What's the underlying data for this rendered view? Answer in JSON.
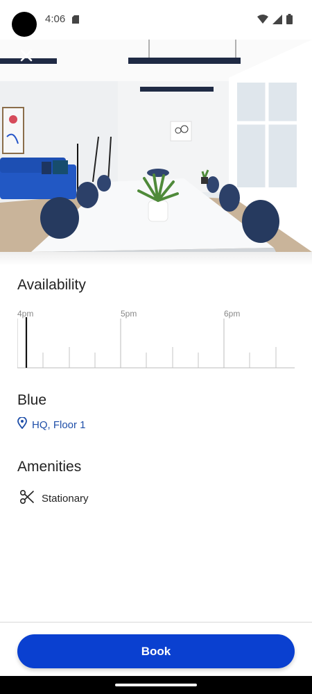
{
  "status_bar": {
    "time": "4:06",
    "icons": [
      "sd-card-icon",
      "wifi-icon",
      "signal-icon",
      "battery-icon"
    ]
  },
  "hero": {
    "close_icon": "close-icon",
    "image_subject": "conference-room-photo"
  },
  "availability": {
    "title": "Availability",
    "hour_labels": [
      "4pm",
      "5pm",
      "6pm"
    ],
    "current_time_marker": "4:06"
  },
  "room": {
    "name": "Blue",
    "location_icon": "location-pin-icon",
    "location": "HQ, Floor 1"
  },
  "amenities": {
    "title": "Amenities",
    "items": [
      {
        "icon": "scissors-icon",
        "label": "Stationary"
      }
    ]
  },
  "footer": {
    "book_label": "Book"
  },
  "colors": {
    "accent": "#0a40d0",
    "link": "#1e4ea8",
    "text": "#222222",
    "muted": "#888888"
  }
}
